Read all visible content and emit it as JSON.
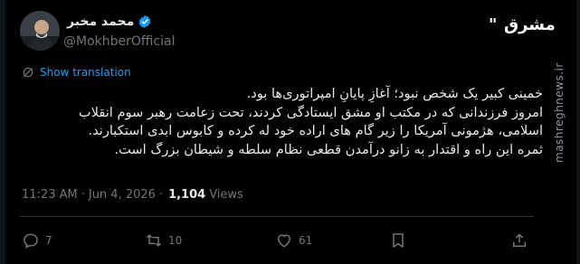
{
  "author": {
    "name": "محمد مخبر",
    "handle": "@MokhberOfficial"
  },
  "watermark": {
    "logo_text": "مشرق",
    "side_text": "mashreghnews.ir"
  },
  "translate": {
    "label": "Show translation"
  },
  "tweet": {
    "lines": [
      "خمینی کبیر یک شخص نبود؛ آغازِ پایانِ امپراتوری‌ها بود.",
      "امروز فرزندانی که در مکتب او مشق ایستادگی کردند، تحت زعامت رهبر سوم انقلاب",
      "اسلامی، هژمونی آمریکا را زیر گام های اراده خود له کرده و کابوس ابدی استکبارند.",
      "ثمره این راه و اقتدار به زانو درآمدن قطعی نظام سلطه و شیطان بزرگ است."
    ]
  },
  "meta": {
    "time": "11:23 AM",
    "separator": "·",
    "date": "Jun 4, 2026",
    "views_count": "1,104",
    "views_label": "Views"
  },
  "actions": {
    "replies": "7",
    "reposts": "10",
    "likes": "61",
    "bookmark_icon": "bookmark-icon",
    "share_icon": "share-icon"
  },
  "colors": {
    "background": "#000000",
    "text": "#e7e9ea",
    "muted": "#71767b",
    "link": "#1d9bf0",
    "verified": "#1d9bf0"
  }
}
